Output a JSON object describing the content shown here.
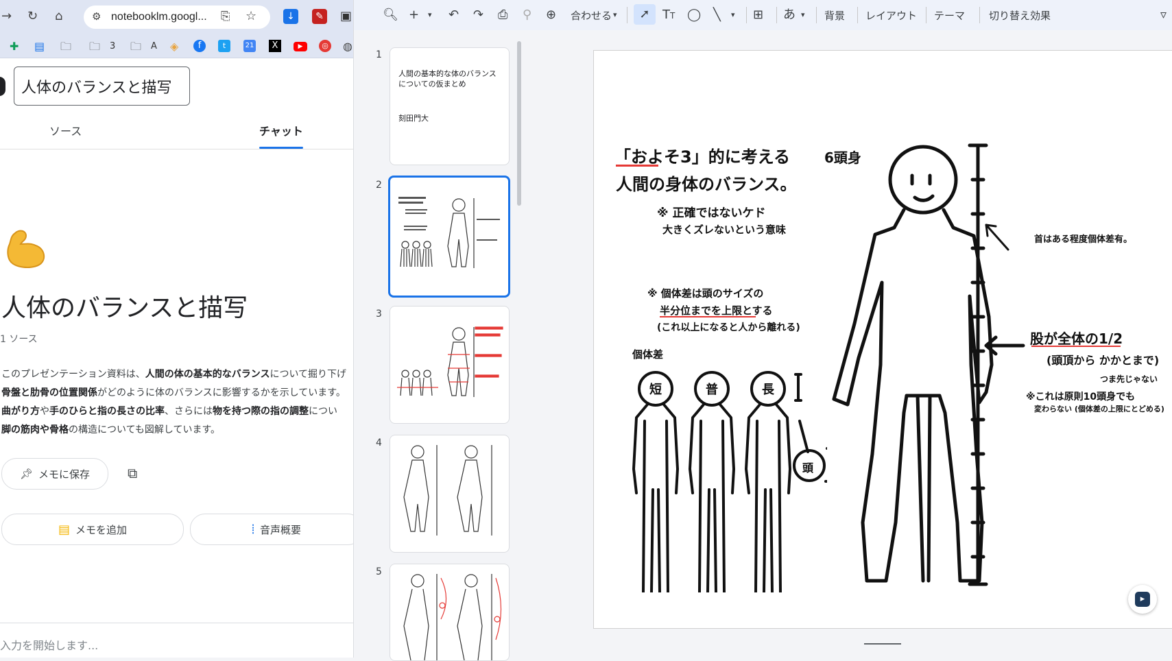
{
  "browser": {
    "url": "notebooklm.googl...",
    "bookmarks": [
      "3",
      "A"
    ]
  },
  "notebook": {
    "title_field": "人体のバランスと描写",
    "tabs": [
      "ソース",
      "チャット"
    ],
    "big_title": "人体のバランスと描写",
    "source_count": "1 ソース",
    "summary": [
      [
        "このプレゼンテーション資料は、",
        "人間の体の基本的なバランス",
        "について掘り下げ"
      ],
      [
        "",
        "骨盤と肋骨の位置関係",
        "がどのように体のバランスに影響するかを示しています。"
      ],
      [
        "",
        "曲がり方",
        "や",
        "手のひらと指の長さの比率",
        "、さらには",
        "物を持つ際の指の調整",
        "につい"
      ],
      [
        "",
        "脚の筋肉や骨格",
        "の構造についても図解しています。"
      ]
    ],
    "save_memo": "メモに保存",
    "add_memo": "メモを追加",
    "audio_overview": "音声概要",
    "chat_placeholder": "入力を開始します..."
  },
  "toolbar": {
    "fit": "合わせる",
    "background": "背景",
    "layout": "レイアウト",
    "theme": "テーマ",
    "transition": "切り替え効果"
  },
  "slides": {
    "numbers": [
      "1",
      "2",
      "3",
      "4",
      "5"
    ],
    "slide1_title": "人間の基本的な体のバランスについての仮まとめ",
    "slide1_author": "刻田門大"
  },
  "main_slide": {
    "heading1": "「およそ3」的に考える",
    "heading2": "人間の身体のバランス。",
    "note1": "※ 正確ではないケド",
    "note2": "大きくズレないという意味",
    "note3": "※ 個体差は頭のサイズの",
    "note4": "半分位までを上限とする",
    "note5": "(これ以上になると人から離れる)",
    "individual": "個体差",
    "heads": [
      "短",
      "普",
      "長"
    ],
    "head_label": "頭",
    "six_heads": "6頭身",
    "neck_note": "首はある程度個体差有。",
    "crotch1": "股が全体の1/2",
    "crotch2": "(頭頂から かかとまで)",
    "toe": "つま先じゃない",
    "rule1": "※これは原則10頭身でも",
    "rule2": "変わらない (個体差の上限にとどめる)"
  }
}
